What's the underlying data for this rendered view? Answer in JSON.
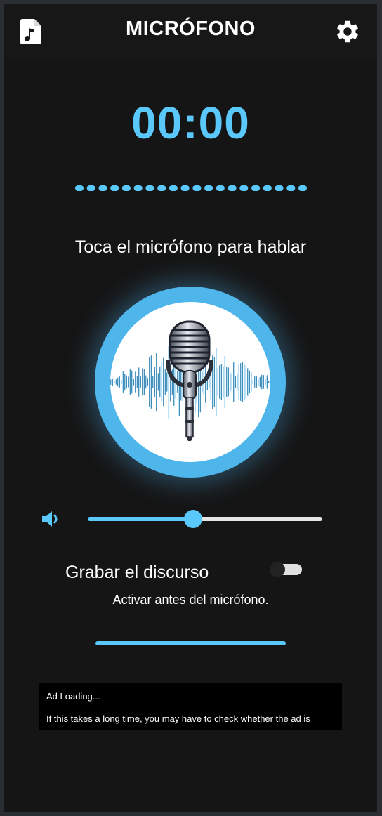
{
  "header": {
    "title": "MICRÓFONO",
    "left_icon": "audio-file-icon",
    "right_icon": "gear-icon"
  },
  "timer": {
    "value": "00:00"
  },
  "prompt": {
    "text": "Toca el micrófono para hablar"
  },
  "mic_button": {
    "icon": "microphone-icon"
  },
  "volume": {
    "icon": "volume-icon",
    "level_fraction": 0.45
  },
  "record_speech": {
    "label": "Grabar el discurso",
    "enabled": false,
    "hint": "Activar antes del micrófono."
  },
  "ad": {
    "line1": "Ad Loading...",
    "line2": "If this takes a long time, you may have to check whether the ad is"
  },
  "colors": {
    "accent": "#5ac8fa",
    "background": "#151515",
    "header_bg": "#171717",
    "text": "#ffffff"
  }
}
